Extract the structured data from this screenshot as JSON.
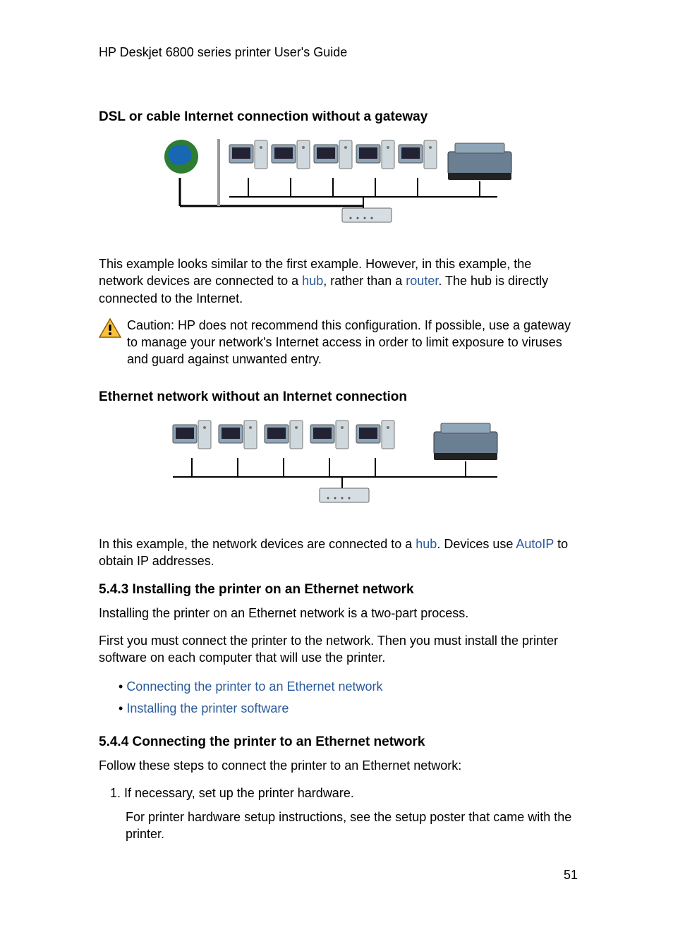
{
  "header": {
    "title": "HP Deskjet 6800 series printer User's Guide"
  },
  "sections": {
    "s1": {
      "heading": "DSL or cable Internet connection without a gateway",
      "para_a": "This example looks similar to the first example. However, in this example, the network devices are connected to a ",
      "link_hub": "hub",
      "para_b": ", rather than a ",
      "link_router": "router",
      "para_c": ". The hub is directly connected to the Internet."
    },
    "caution": {
      "text": "Caution: HP does not recommend this configuration. If possible, use a gateway to manage your network's Internet access in order to limit exposure to viruses and guard against unwanted entry."
    },
    "s2": {
      "heading": "Ethernet network without an Internet connection",
      "para_a": "In this example, the network devices are connected to a ",
      "link_hub": "hub",
      "para_b": ". Devices use ",
      "link_autoip": "AutoIP",
      "para_c": " to obtain IP addresses."
    },
    "s3": {
      "heading": "5.4.3  Installing the printer on an Ethernet network",
      "p1": "Installing the printer on an Ethernet network is a two-part process.",
      "p2": "First you must connect the printer to the network. Then you must install the printer software on each computer that will use the printer.",
      "link1": "Connecting the printer to an Ethernet network",
      "link2": "Installing the printer software"
    },
    "s4": {
      "heading": "5.4.4  Connecting the printer to an Ethernet network",
      "p1": "Follow these steps to connect the printer to an Ethernet network:",
      "step1_num": "1.",
      "step1_text": "If necessary, set up the printer hardware.",
      "step1_sub": "For printer hardware setup instructions, see the setup poster that came with the printer."
    },
    "page_number": "51"
  }
}
